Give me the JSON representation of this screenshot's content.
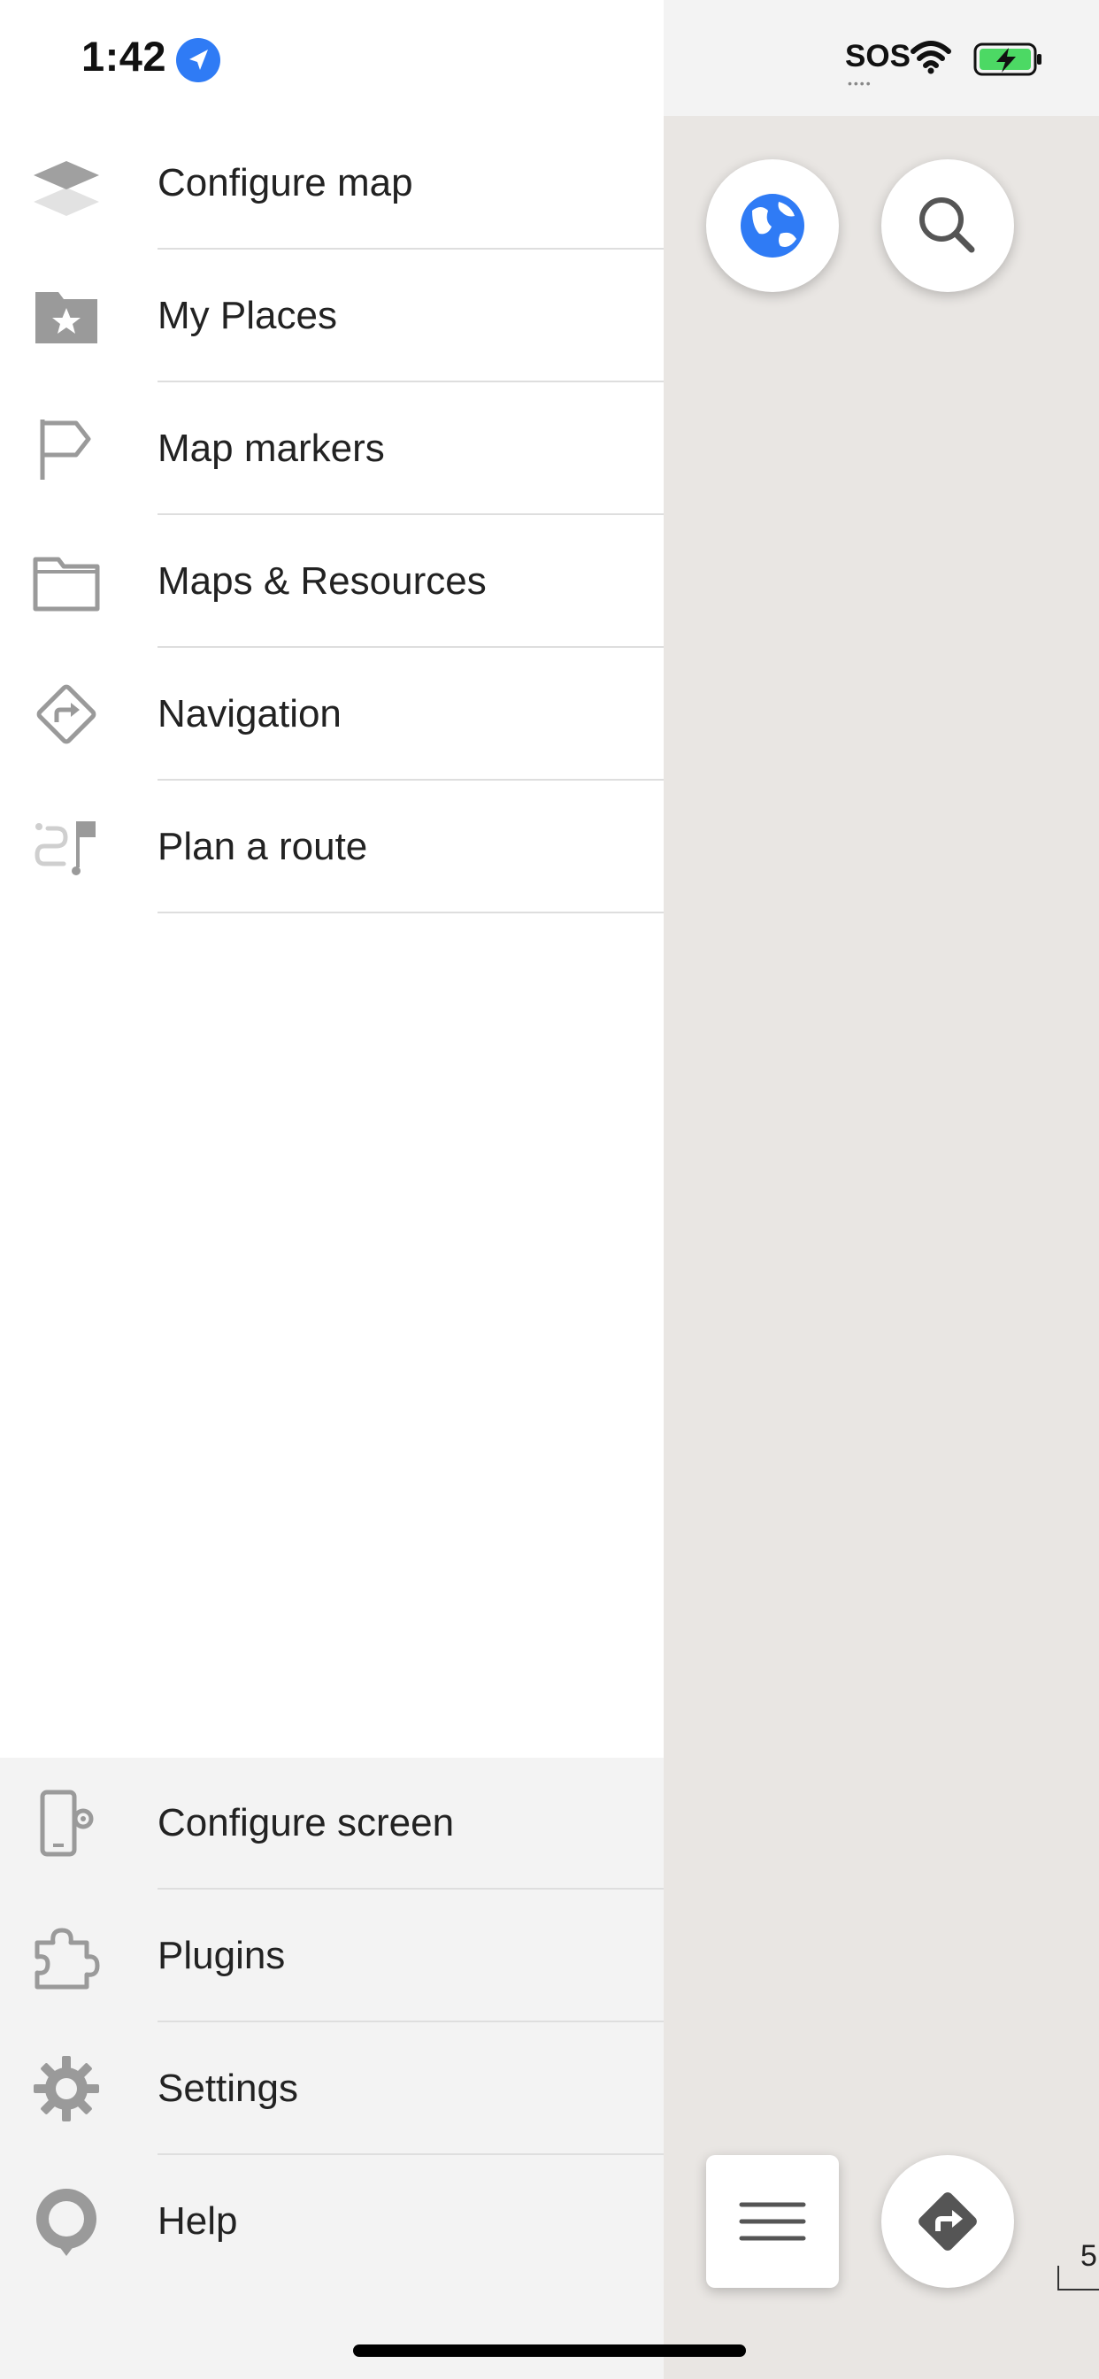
{
  "status_bar": {
    "time": "1:42",
    "sos": "SOS",
    "icons": [
      "location-arrow-icon",
      "wifi-icon",
      "battery-charging-icon"
    ],
    "battery_color": "#4cd964"
  },
  "drawer": {
    "top_items": [
      {
        "label": "Configure map",
        "icon": "layers-icon"
      },
      {
        "label": "My Places",
        "icon": "folder-star-icon"
      },
      {
        "label": "Map markers",
        "icon": "flag-icon"
      },
      {
        "label": "Maps & Resources",
        "icon": "folder-icon"
      },
      {
        "label": "Navigation",
        "icon": "navigation-diamond-icon"
      },
      {
        "label": "Plan a route",
        "icon": "plan-route-icon"
      }
    ],
    "bottom_items": [
      {
        "label": "Configure screen",
        "icon": "phone-gear-icon"
      },
      {
        "label": "Plugins",
        "icon": "puzzle-icon"
      },
      {
        "label": "Settings",
        "icon": "gear-icon"
      },
      {
        "label": "Help",
        "icon": "help-bubble-icon"
      }
    ]
  },
  "map": {
    "buttons": [
      "globe-icon",
      "search-icon",
      "menu-icon",
      "directions-icon"
    ],
    "scale_label": "5",
    "accent_color": "#2f7bf5",
    "icon_color": "#9a9a9a"
  }
}
